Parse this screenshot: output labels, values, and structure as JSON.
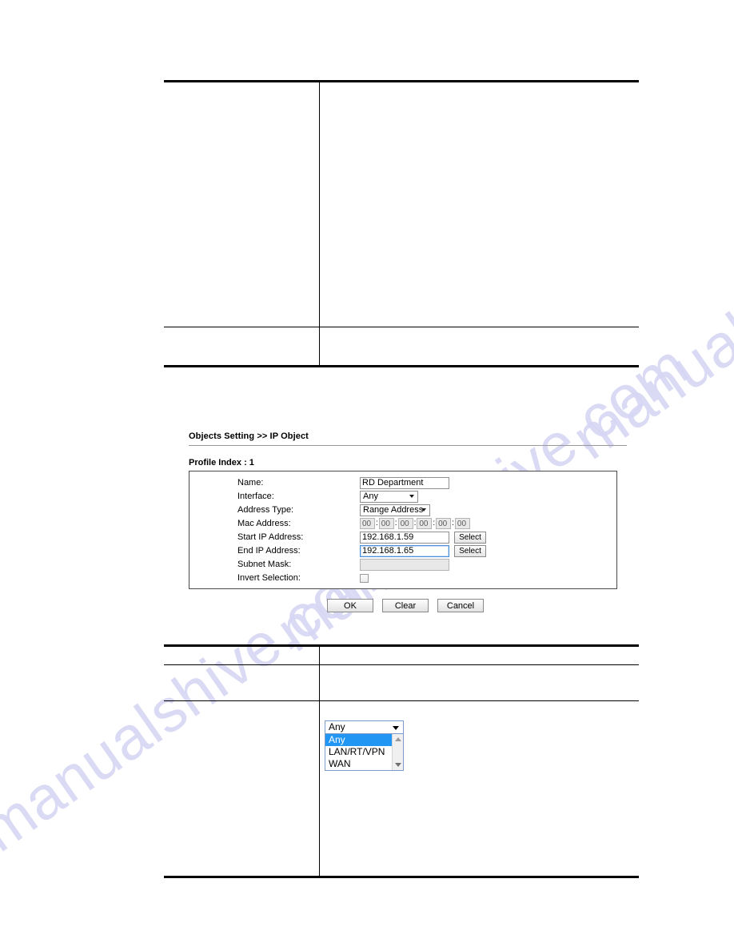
{
  "watermark": {
    "text": "manualshive.com",
    "color": "#d7d7f5"
  },
  "router_ui": {
    "breadcrumb": "Objects Setting >> IP Object",
    "profile_index_label": "Profile Index : 1",
    "fields": {
      "name": {
        "label": "Name:",
        "value": "RD Department"
      },
      "interface": {
        "label": "Interface:",
        "value": "Any"
      },
      "address_type": {
        "label": "Address Type:",
        "value": "Range Address"
      },
      "mac_address": {
        "label": "Mac Address:",
        "octets": [
          "00",
          "00",
          "00",
          "00",
          "00",
          "00"
        ],
        "separator": ":"
      },
      "start_ip": {
        "label": "Start IP Address:",
        "value": "192.168.1.59",
        "button": "Select"
      },
      "end_ip": {
        "label": "End IP Address:",
        "value": "192.168.1.65",
        "button": "Select"
      },
      "subnet_mask": {
        "label": "Subnet Mask:",
        "value": ""
      },
      "invert_selection": {
        "label": "Invert Selection:",
        "checked": false
      }
    },
    "actions": {
      "ok": "OK",
      "clear": "Clear",
      "cancel": "Cancel"
    }
  },
  "interface_dropdown": {
    "selected": "Any",
    "options": [
      "Any",
      "LAN/RT/VPN",
      "WAN"
    ],
    "highlight_color": "#2196f3"
  },
  "top_table": {
    "rows": [
      {
        "label": "",
        "description": ""
      },
      {
        "label": "",
        "description": ""
      }
    ]
  },
  "bottom_table": {
    "rows": [
      {
        "label": "",
        "description": ""
      },
      {
        "label": "",
        "description": ""
      },
      {
        "label": "",
        "description": ""
      }
    ]
  }
}
